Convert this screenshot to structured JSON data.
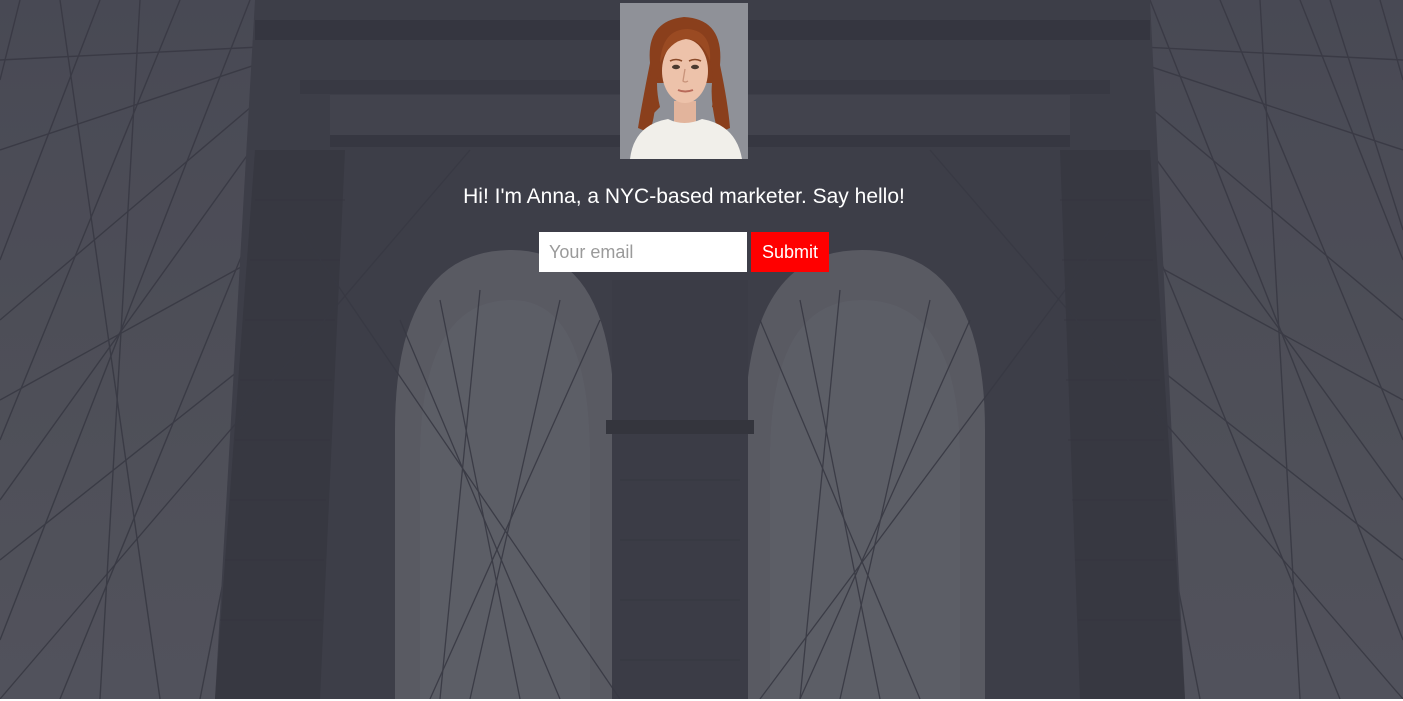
{
  "profile": {
    "avatar_alt": "Anna",
    "tagline": "Hi! I'm Anna, a NYC-based marketer. Say hello!"
  },
  "signup": {
    "email_placeholder": "Your email",
    "email_value": "",
    "submit_label": "Submit"
  },
  "colors": {
    "overlay": "#52535d",
    "submit_background": "#ff0000",
    "text": "#ffffff"
  }
}
